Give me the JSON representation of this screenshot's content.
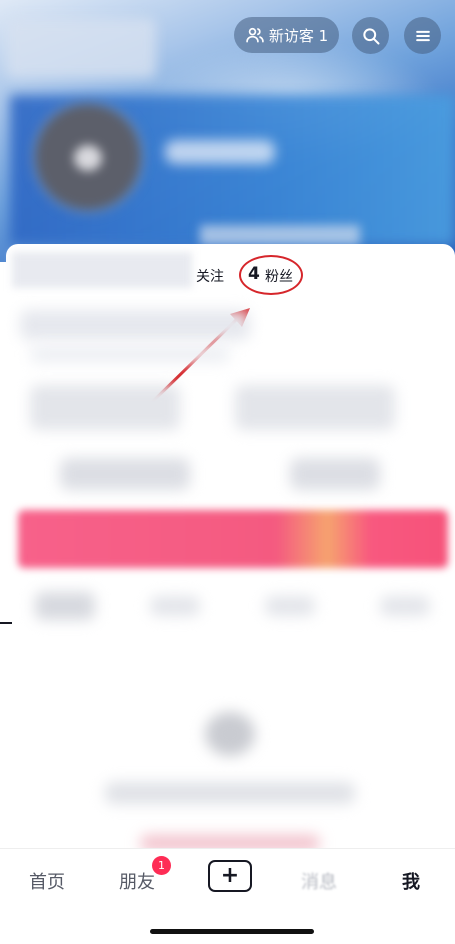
{
  "header": {
    "visitor_label": "新访客 1",
    "visitor_icon": "people-icon",
    "search_icon": "search-icon",
    "menu_icon": "menu-icon"
  },
  "stats": {
    "follow_label": "关注",
    "fans_count": "4",
    "fans_label": "粉丝",
    "highlight_color": "#d6262b"
  },
  "tabbar": {
    "home": "首页",
    "friends": "朋友",
    "friends_badge": "1",
    "create": "+",
    "messages": "消息",
    "me": "我"
  },
  "colors": {
    "accent": "#fe2c55",
    "pink_banner": "#f45a80"
  }
}
